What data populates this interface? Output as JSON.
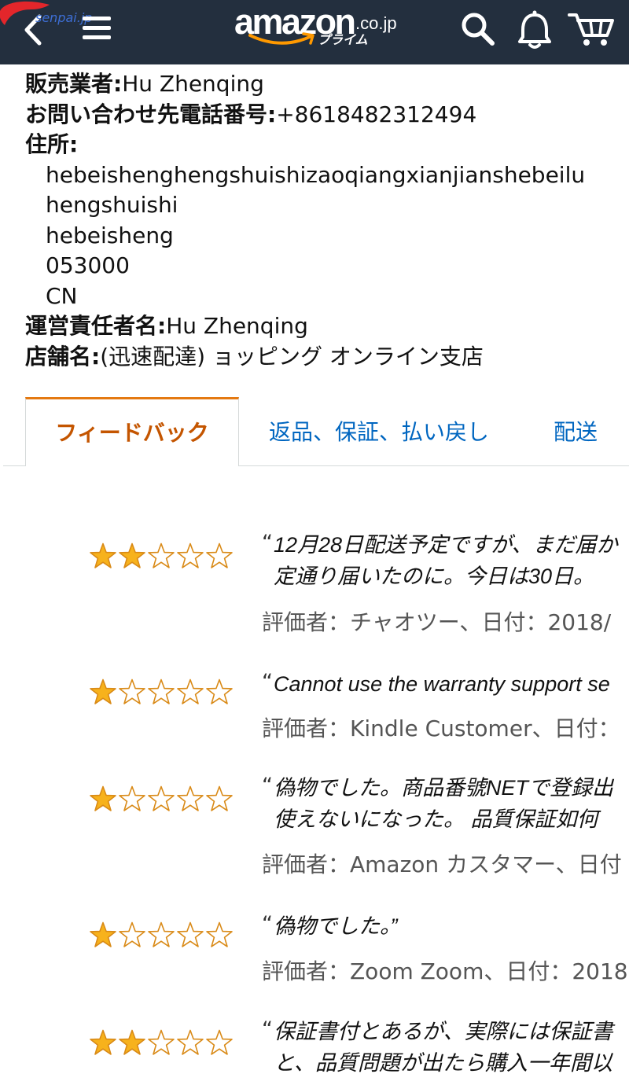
{
  "watermark": {
    "text": "senpai.jp"
  },
  "header": {
    "logo": {
      "wordmark": "amazon",
      "domain": ".co.jp",
      "tagline": "プライム"
    },
    "icons": [
      "chevron-left-icon",
      "hamburger-menu-icon",
      "search-icon",
      "bell-icon",
      "cart-icon"
    ]
  },
  "seller": {
    "business_name": {
      "label": "販売業者:",
      "value": "Hu Zhenqing"
    },
    "phone": {
      "label": "お問い合わせ先電話番号:",
      "value": "+8618482312494"
    },
    "address": {
      "label": "住所:",
      "lines": [
        "hebeishenghengshuishizaoqiangxianjianshebeilu",
        "hengshuishi",
        "hebeisheng",
        "053000",
        "CN"
      ]
    },
    "manager": {
      "label": "運営責任者名:",
      "value": "Hu Zhenqing"
    },
    "store_name": {
      "label": "店舗名:",
      "value": "(迅速配達) ョッピング オンライン支店"
    }
  },
  "tabs": [
    {
      "label": "フィードバック",
      "active": true
    },
    {
      "label": "返品、保証、払い戻し",
      "active": false
    },
    {
      "label": "配送",
      "active": false
    }
  ],
  "feedback": {
    "open_quote": "“",
    "items": [
      {
        "rating": 2,
        "max_rating": 5,
        "lines": [
          "12月28日配送予定ですが、まだ届か",
          "定通り届いたのに。今日は30日。"
        ],
        "rater": "評価者：チャオツー、日付：2018/"
      },
      {
        "rating": 1,
        "max_rating": 5,
        "lines": [
          "Cannot use the warranty support se"
        ],
        "rater": "評価者：Kindle Customer、日付："
      },
      {
        "rating": 1,
        "max_rating": 5,
        "lines": [
          "偽物でした。商品番號NETで登録出",
          "使えないになった。 品質保証如何"
        ],
        "rater": "評価者：Amazon カスタマー、日付"
      },
      {
        "rating": 1,
        "max_rating": 5,
        "lines": [
          "偽物でした。”"
        ],
        "rater": "評価者：Zoom Zoom、日付：2018"
      },
      {
        "rating": 2,
        "max_rating": 5,
        "lines": [
          "保証書付とあるが、実際には保証書",
          "と、品質問題が出たら購入一年間以"
        ]
      }
    ]
  },
  "colors": {
    "header_bg": "#232f3e",
    "logo_smile": "#ff9900",
    "tab_active_text": "#c45500",
    "tab_active_border": "#e47911",
    "link": "#0066c0",
    "rater_text": "#555555",
    "star_fill": "#f7b21c",
    "star_empty_fill": "#ffffff",
    "star_stroke": "#d98a17"
  }
}
